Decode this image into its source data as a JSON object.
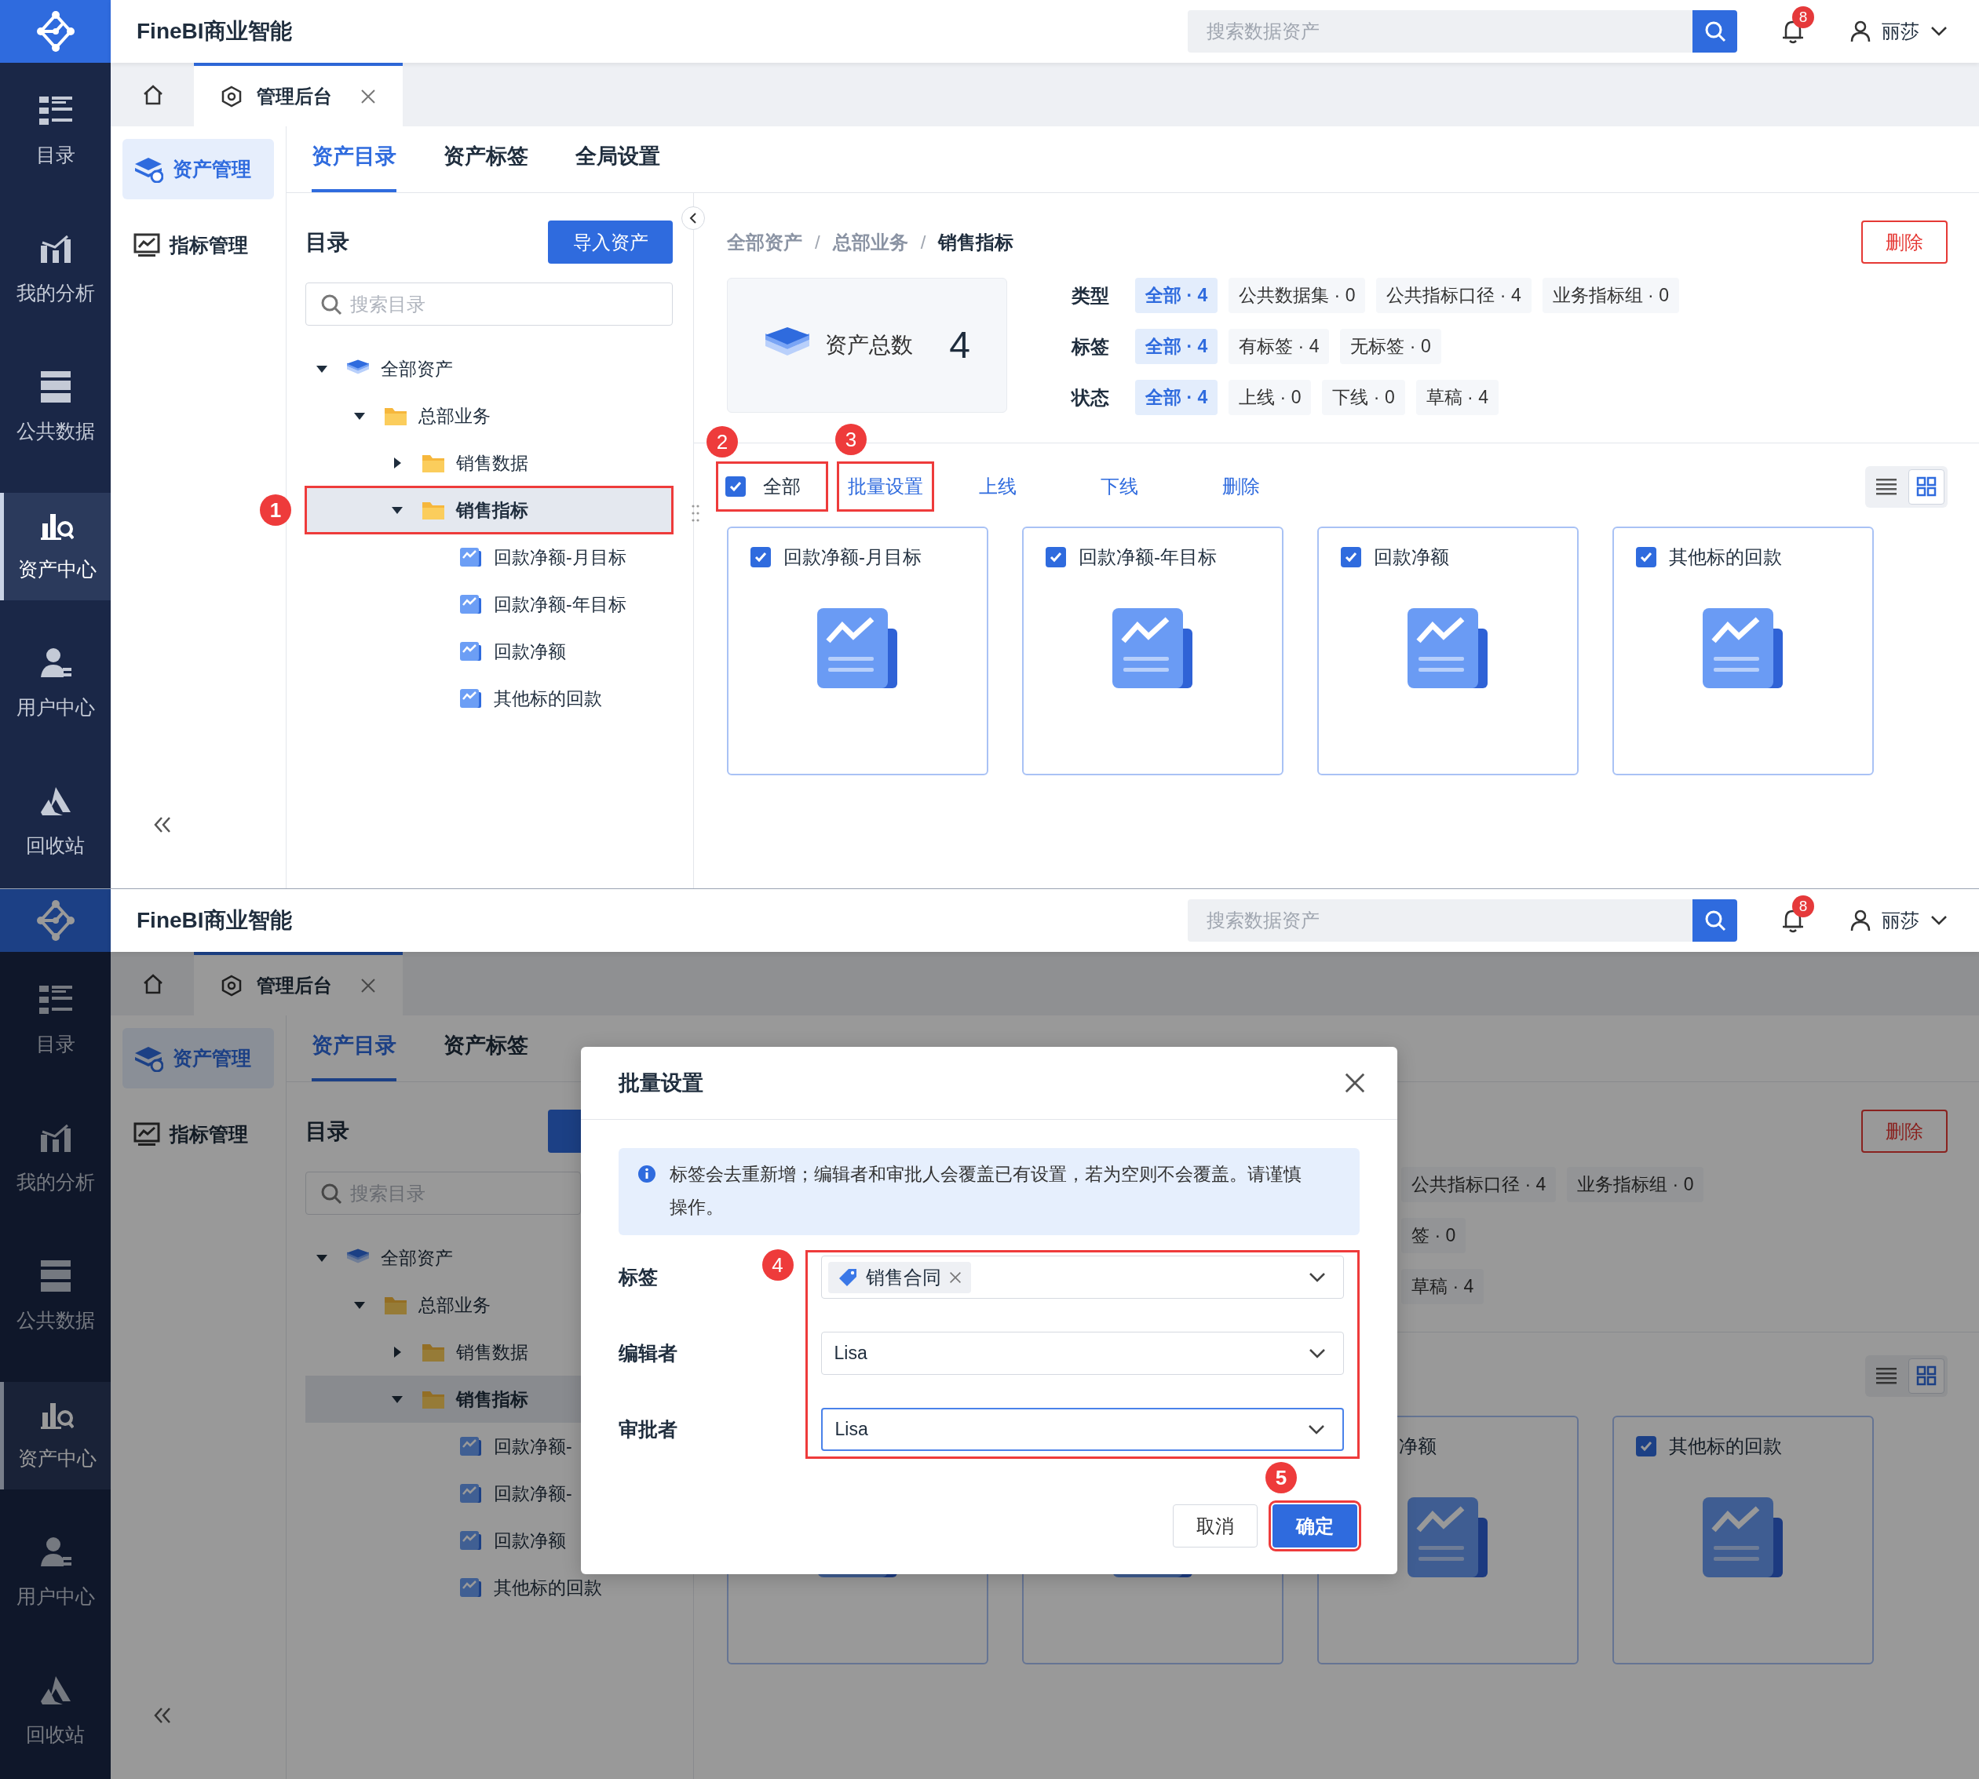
{
  "screens": [
    {
      "app_title": "FineBI商业智能",
      "search_placeholder": "搜索数据资产",
      "notification_count": "8",
      "user_name": "丽莎",
      "nav": [
        {
          "label": "目录",
          "selected": false
        },
        {
          "label": "我的分析",
          "selected": false
        },
        {
          "label": "公共数据",
          "selected": false
        },
        {
          "label": "资产中心",
          "selected": true
        },
        {
          "label": "用户中心",
          "selected": false
        },
        {
          "label": "回收站",
          "selected": false
        }
      ],
      "open_tab": {
        "label": "管理后台"
      },
      "side_menu": [
        {
          "label": "资产管理",
          "selected": true
        },
        {
          "label": "指标管理",
          "selected": false
        }
      ],
      "section_tabs": [
        {
          "label": "资产目录",
          "selected": true
        },
        {
          "label": "资产标签",
          "selected": false
        },
        {
          "label": "全局设置",
          "selected": false
        }
      ],
      "catalog": {
        "title": "目录",
        "import_button": {
          "label": "导入资产",
          "covered": false
        },
        "search_placeholder": "搜索目录",
        "tree": [
          {
            "label": "全部资产",
            "kind": "root",
            "expanded": true,
            "selected": false,
            "children": [
              {
                "label": "总部业务",
                "kind": "folder",
                "expanded": true,
                "selected": false,
                "children": [
                  {
                    "label": "销售数据",
                    "kind": "folder",
                    "expanded": false,
                    "selected": false
                  },
                  {
                    "label": "销售指标",
                    "kind": "folder",
                    "expanded": true,
                    "selected": true,
                    "callout": "1",
                    "children": [
                      {
                        "label": "回款净额-月目标",
                        "kind": "metric",
                        "selected": false
                      },
                      {
                        "label": "回款净额-年目标",
                        "kind": "metric",
                        "selected": false
                      },
                      {
                        "label": "回款净额",
                        "kind": "metric",
                        "selected": false
                      },
                      {
                        "label": "其他标的回款",
                        "kind": "metric",
                        "selected": false
                      }
                    ]
                  }
                ]
              }
            ]
          }
        ]
      },
      "breadcrumb": [
        {
          "label": "全部资产",
          "kind": "link"
        },
        {
          "label": "/",
          "kind": "separator"
        },
        {
          "label": "总部业务",
          "kind": "link"
        },
        {
          "label": "/",
          "kind": "separator"
        },
        {
          "label": "销售指标",
          "kind": "current"
        }
      ],
      "delete_button": "删除",
      "summary": {
        "label": "资产总数",
        "value": "4"
      },
      "filters": [
        {
          "label": "类型",
          "options": [
            {
              "label": "全部 · 4",
              "selected": true
            },
            {
              "label": "公共数据集 · 0",
              "selected": false
            },
            {
              "label": "公共指标口径 · 4",
              "selected": false
            },
            {
              "label": "业务指标组 · 0",
              "selected": false
            }
          ]
        },
        {
          "label": "标签",
          "options": [
            {
              "label": "全部 · 4",
              "selected": true
            },
            {
              "label": "有标签 · 4",
              "selected": false
            },
            {
              "label": "无标签 · 0",
              "selected": false
            }
          ]
        },
        {
          "label": "状态",
          "options": [
            {
              "label": "全部 · 4",
              "selected": true
            },
            {
              "label": "上线 · 0",
              "selected": false
            },
            {
              "label": "下线 · 0",
              "selected": false
            },
            {
              "label": "草稿 · 4",
              "selected": false
            }
          ]
        }
      ],
      "select_all": {
        "label": "全部",
        "checked": true,
        "callout": "2"
      },
      "actions": [
        {
          "label": "批量设置",
          "callout": "3"
        },
        {
          "label": "上线"
        },
        {
          "label": "下线"
        },
        {
          "label": "删除"
        }
      ],
      "view_modes": [
        {
          "kind": "list",
          "selected": false
        },
        {
          "kind": "grid",
          "selected": true
        }
      ],
      "cards": [
        {
          "kind": "asset",
          "title": "回款净额-月目标",
          "checked": true
        },
        {
          "kind": "asset",
          "title": "回款净额-年目标",
          "checked": true
        },
        {
          "kind": "asset",
          "title": "回款净额",
          "checked": true
        },
        {
          "kind": "asset",
          "title": "其他标的回款",
          "checked": true
        }
      ]
    },
    {
      "app_title": "FineBI商业智能",
      "search_placeholder": "搜索数据资产",
      "notification_count": "8",
      "user_name": "丽莎",
      "nav": [
        {
          "label": "目录",
          "selected": false
        },
        {
          "label": "我的分析",
          "selected": false
        },
        {
          "label": "公共数据",
          "selected": false
        },
        {
          "label": "资产中心",
          "selected": true
        },
        {
          "label": "用户中心",
          "selected": false
        },
        {
          "label": "回收站",
          "selected": false
        }
      ],
      "open_tab": {
        "label": "管理后台"
      },
      "side_menu": [
        {
          "label": "资产管理",
          "selected": true
        },
        {
          "label": "指标管理",
          "selected": false
        }
      ],
      "section_tabs": [
        {
          "label": "资产目录",
          "selected": true
        },
        {
          "label": "资产标签",
          "selected": false
        }
      ],
      "catalog": {
        "title": "目录",
        "import_button": {
          "covered": true
        },
        "search_placeholder": "搜索目录",
        "tree": [
          {
            "label": "全部资产",
            "kind": "root",
            "expanded": true,
            "selected": false,
            "children": [
              {
                "label": "总部业务",
                "kind": "folder",
                "expanded": true,
                "selected": false,
                "children": [
                  {
                    "label": "销售数据",
                    "kind": "folder",
                    "expanded": false,
                    "selected": false
                  },
                  {
                    "label": "销售指标",
                    "kind": "folder",
                    "expanded": true,
                    "selected": true,
                    "children": [
                      {
                        "label": "回款净额-",
                        "kind": "metric",
                        "selected": false
                      },
                      {
                        "label": "回款净额-",
                        "kind": "metric",
                        "selected": false
                      },
                      {
                        "label": "回款净额",
                        "kind": "metric",
                        "selected": false
                      },
                      {
                        "label": "其他标的回款",
                        "kind": "metric",
                        "selected": false
                      }
                    ]
                  }
                ]
              }
            ]
          }
        ]
      },
      "delete_button": "删除",
      "filters": [
        {
          "options": [
            {
              "label": "公共指标口径 · 4",
              "selected": false
            },
            {
              "label": "业务指标组 · 0",
              "selected": false
            }
          ]
        },
        {
          "options": [
            {
              "label": "签 · 0",
              "selected": false
            }
          ]
        },
        {
          "options": [
            {
              "label": "草稿 · 4",
              "selected": false
            }
          ]
        }
      ],
      "view_modes": [
        {
          "kind": "list",
          "selected": false
        },
        {
          "kind": "grid",
          "selected": true
        }
      ],
      "cards": [
        {
          "kind": "asset"
        },
        {
          "kind": "asset"
        },
        {
          "kind": "asset",
          "title": "净额"
        },
        {
          "kind": "asset",
          "title": "其他标的回款",
          "checked": true
        }
      ],
      "dialog": {
        "title": "批量设置",
        "notice": "标签会去重新增；编辑者和审批人会覆盖已有设置，若为空则不会覆盖。请谨慎操作。",
        "fields_callout": "4",
        "fields": [
          {
            "label": "标签",
            "kind": "tags",
            "tags": [
              "销售合同"
            ],
            "focused": false
          },
          {
            "label": "编辑者",
            "kind": "select",
            "value": "Lisa",
            "focused": false
          },
          {
            "label": "审批者",
            "kind": "select",
            "value": "Lisa",
            "focused": true
          }
        ],
        "buttons": [
          {
            "label": "取消",
            "kind": "secondary"
          },
          {
            "label": "确定",
            "kind": "primary",
            "callout": "5"
          }
        ]
      }
    }
  ]
}
